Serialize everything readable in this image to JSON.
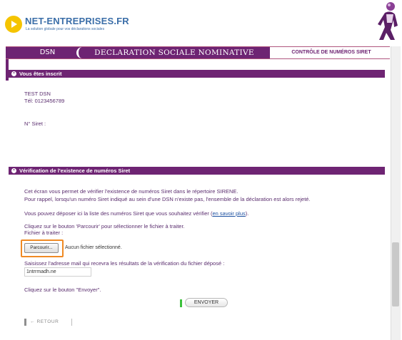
{
  "brand": {
    "name": "NET-ENTREPRISES.FR",
    "tagline": "La solution globale pour vos déclarations sociales"
  },
  "nav": {
    "left": "DSN",
    "middle": "DECLARATION SOCIALE NOMINATIVE",
    "right": "CONTRÔLE DE NUMÉROS SIRET"
  },
  "registered": {
    "title": "Vous êtes inscrit",
    "name": "TEST DSN",
    "phone": "Tél: 0123456789",
    "siret_label": "N° Siret :"
  },
  "verification": {
    "title": "Vérification de l'existence de numéros Siret",
    "intro_line1": "Cet écran vous permet de vérifier l'existence de numéros Siret dans le répertoire SIRENE.",
    "intro_line2": "Pour rappel, lorsqu'un numéro Siret indiqué au sein d'une DSN n'existe pas, l'ensemble de la déclaration est alors rejeté.",
    "deposit_text": "Vous pouvez déposer ici la liste des numéros Siret que vous souhaitez vérifier (",
    "learn_more": "en savoir plus",
    "deposit_end": ").",
    "browse_instruction": "Cliquez sur le bouton 'Parcourir' pour sélectionner le fichier à traiter.",
    "file_label": "Fichier à traiter :",
    "browse_button": "Parcourir...",
    "no_file": "Aucun fichier sélectionné.",
    "email_instruction": "Saisissez l'adresse mail qui recevra les résultats de la vérification du fichier déposé :",
    "email_value": "1ntrrmadh.ne",
    "send_instruction": "Cliquez sur le bouton \"Envoyer\".",
    "send_button": "ENVOYER",
    "back_button": "← RETOUR"
  },
  "colors": {
    "accent": "#6e2473",
    "highlight": "#f08a24",
    "link": "#1b4fa0"
  }
}
